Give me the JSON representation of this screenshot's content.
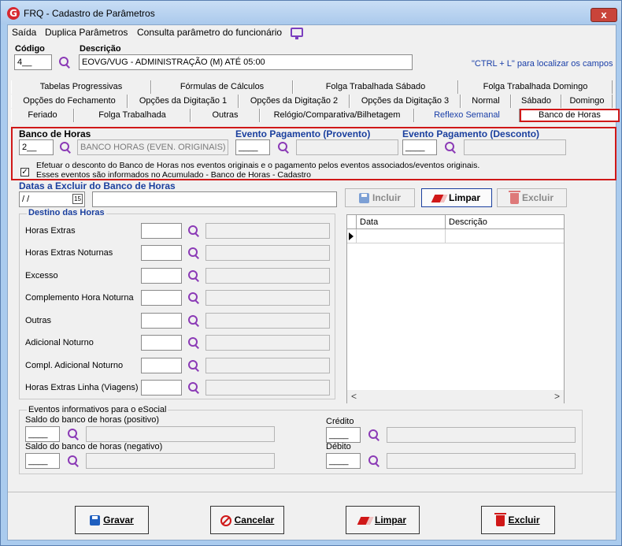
{
  "window": {
    "title": "FRQ - Cadastro de Parâmetros",
    "logo_letter": "G",
    "close_glyph": "x"
  },
  "menu": {
    "items": [
      "Saída",
      "Duplica Parâmetros",
      "Consulta parâmetro do funcionário"
    ],
    "icon": "monitor-icon"
  },
  "header": {
    "codigo_label": "Código",
    "codigo_value": "4__",
    "descricao_label": "Descrição",
    "descricao_value": "EOVG/VUG - ADMINISTRAÇÃO (M) ATÉ 05:00",
    "hint": "\"CTRL + L\" para localizar os campos"
  },
  "tabs": {
    "row1": [
      "Tabelas Progressivas",
      "Fórmulas de Cálculos",
      "Folga Trabalhada Sábado",
      "Folga Trabalhada Domingo"
    ],
    "row2": [
      "Opções do Fechamento",
      "Opções da Digitação 1",
      "Opções da Digitação 2",
      "Opções da Digitação 3",
      "Normal",
      "Sábado",
      "Domingo"
    ],
    "row3": [
      "Feriado",
      "Folga Trabalhada",
      "Outras",
      "Relógio/Comparativa/Bilhetagem",
      "Reflexo Semanal",
      "Banco de Horas"
    ],
    "active": "Banco de Horas"
  },
  "banco": {
    "label": "Banco de Horas",
    "code": "2__",
    "desc": "BANCO HORAS (EVEN. ORIGINAIS)",
    "provento_label": "Evento Pagamento (Provento)",
    "provento_code": "____",
    "desconto_label": "Evento Pagamento (Desconto)",
    "desconto_code": "____",
    "check_text_1": "Efetuar o desconto do Banco de Horas nos eventos originais e o pagamento pelos eventos associados/eventos originais.",
    "check_text_2": "Esses eventos são informados no Acumulado - Banco de Horas - Cadastro",
    "check_mark": "✓"
  },
  "datas": {
    "label": "Datas a Excluir do Banco de Horas",
    "date_value": " / /",
    "cal_glyph": "15"
  },
  "toolbar": {
    "incluir": "Incluir",
    "limpar": "Limpar",
    "excluir": "Excluir"
  },
  "destino": {
    "title": "Destino das Horas",
    "rows": [
      "Horas Extras",
      "Horas Extras Noturnas",
      "Excesso",
      "Complemento Hora Noturna",
      "Outras",
      "Adicional Noturno",
      "Compl. Adicional Noturno",
      "Horas Extras Linha (Viagens)"
    ]
  },
  "grid": {
    "columns": [
      "Data",
      "Descrição"
    ],
    "scroll_left": "<",
    "scroll_right": ">"
  },
  "esocial": {
    "title": "Eventos informativos para o eSocial",
    "saldo_pos": "Saldo do banco de horas (positivo)",
    "saldo_neg": "Saldo do banco de horas (negativo)",
    "credito": "Crédito",
    "debito": "Débito",
    "blank": "____"
  },
  "footer": {
    "gravar": "Gravar",
    "cancelar": "Cancelar",
    "limpar": "Limpar",
    "excluir": "Excluir"
  },
  "colors": {
    "title_bg": "#aacbee",
    "active_tab_border": "#d01818",
    "accent_purple": "#8b3ab6",
    "link_blue": "#1a3fa8"
  }
}
